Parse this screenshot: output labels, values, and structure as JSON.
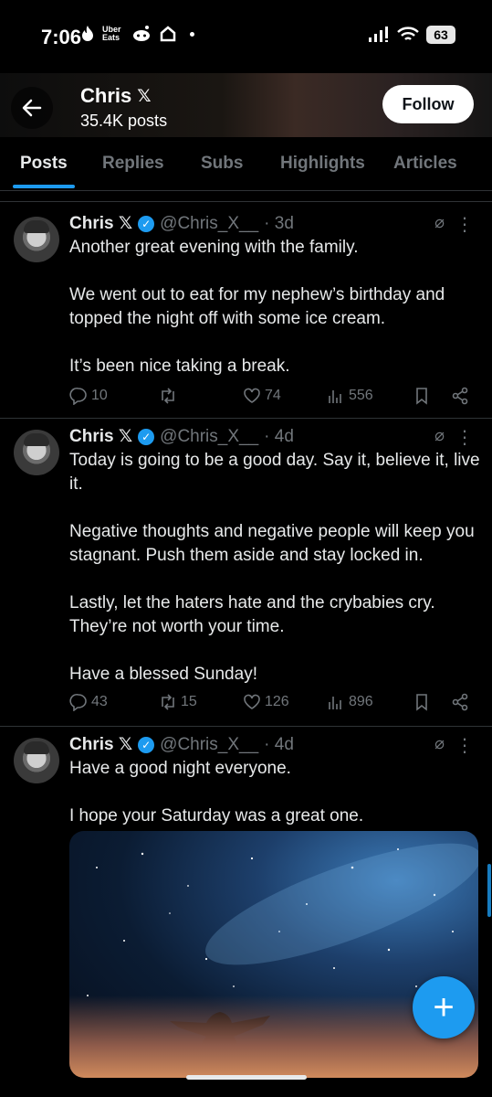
{
  "status_bar": {
    "time": "7:06",
    "battery": "63",
    "app_label": "Uber Eats"
  },
  "header": {
    "name": "Chris",
    "name_badge": "𝕏",
    "post_count": "35.4K posts",
    "follow_label": "Follow"
  },
  "tabs": [
    "Posts",
    "Replies",
    "Subs",
    "Highlights",
    "Articles"
  ],
  "posts": [
    {
      "name": "Chris 𝕏",
      "handle": "@Chris_X__",
      "time": "· 3d",
      "paragraphs": [
        "Another great evening with the family.",
        "We went out to eat for my nephew’s birthday and topped the night off with some ice cream.",
        "It’s been nice taking a break."
      ],
      "replies": "10",
      "reposts": "",
      "likes": "74",
      "views": "556"
    },
    {
      "name": "Chris 𝕏",
      "handle": "@Chris_X__",
      "time": "· 4d",
      "paragraphs": [
        "Today is going to be a good day. Say it, believe it, live it.",
        "Negative thoughts and negative people will keep you stagnant. Push them aside and stay locked in.",
        "Lastly, let the haters hate and the crybabies cry. They’re not worth your time.",
        "Have a blessed Sunday!"
      ],
      "replies": "43",
      "reposts": "15",
      "likes": "126",
      "views": "896"
    },
    {
      "name": "Chris 𝕏",
      "handle": "@Chris_X__",
      "time": "· 4d",
      "paragraphs": [
        "Have a good night everyone.",
        "I hope your Saturday was a great one."
      ]
    }
  ],
  "fab_symbol": "+",
  "colors": {
    "accent": "#1d9bf0",
    "background": "#000000",
    "muted": "#71767b",
    "text": "#e7e9ea"
  }
}
